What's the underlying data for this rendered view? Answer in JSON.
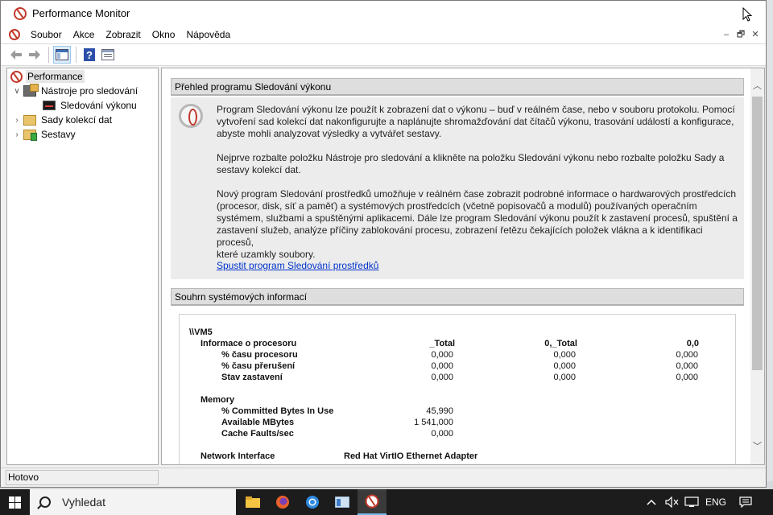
{
  "window": {
    "title": "Performance Monitor",
    "mdi_controls": [
      "–",
      "🗗",
      "✕"
    ]
  },
  "menu": [
    "Soubor",
    "Akce",
    "Zobrazit",
    "Okno",
    "Nápověda"
  ],
  "toolbar_icons": [
    "back-arrow-icon",
    "forward-arrow-icon",
    "show-hide-console-tree-icon",
    "help-icon",
    "properties-icon"
  ],
  "tree": {
    "root": "Performance",
    "items": [
      {
        "label": "Nástroje pro sledování",
        "expanded": true
      },
      {
        "label": "Sledování výkonu"
      },
      {
        "label": "Sady kolekcí dat",
        "expanded": false
      },
      {
        "label": "Sestavy",
        "expanded": false
      }
    ]
  },
  "overview": {
    "header": "Přehled programu Sledování výkonu",
    "p1_l1": "Program Sledování výkonu lze použít k zobrazení dat o výkonu – buď v reálném čase, nebo v souboru protokolu. Pomocí",
    "p1_l2": "vytvoření sad kolekcí dat nakonfigurujte a naplánujte shromažďování dat čítačů výkonu, trasování událostí a konfigurace,",
    "p1_l3": "abyste mohli analyzovat výsledky a vytvářet sestavy.",
    "p2_l1": "Nejprve rozbalte položku Nástroje pro sledování a klikněte na položku Sledování výkonu nebo rozbalte položku Sady a",
    "p2_l2": "sestavy kolekcí dat.",
    "p3_l1": "Nový program Sledování prostředků umožňuje v reálném čase zobrazit podrobné informace o hardwarových prostředcích",
    "p3_l2": "(procesor, disk, síť a paměť) a systémových prostředcích (včetně popisovačů a modulů) používaných operačním",
    "p3_l3": "systémem, službami a spuštěnými aplikacemi. Dále lze program Sledování výkonu použít k zastavení procesů, spuštění a",
    "p3_l4": "zastavení služeb, analýze příčiny zablokování procesu, zobrazení řetězu čekajících položek vlákna a k identifikaci procesů,",
    "p3_l5": "které uzamkly soubory.",
    "link": "Spustit program Sledování prostředků"
  },
  "sysinfo": {
    "header": "Souhrn systémových informací",
    "machine": "\\\\VM5",
    "cpu_title": "Informace o procesoru",
    "cols": [
      "_Total",
      "0,_Total",
      "0,0"
    ],
    "cpu_rows": [
      {
        "label": "% času procesoru",
        "values": [
          "0,000",
          "0,000",
          "0,000"
        ]
      },
      {
        "label": "% času přerušení",
        "values": [
          "0,000",
          "0,000",
          "0,000"
        ]
      },
      {
        "label": "Stav zastavení",
        "values": [
          "0,000",
          "0,000",
          "0,000"
        ]
      }
    ],
    "mem_title": "Memory",
    "mem_rows": [
      {
        "label": "% Committed Bytes In Use",
        "value": "45,990"
      },
      {
        "label": "Available MBytes",
        "value": "1 541,000"
      },
      {
        "label": "Cache Faults/sec",
        "value": "0,000"
      }
    ],
    "net_title": "Network Interface",
    "net_adapter": "Red Hat VirtIO Ethernet Adapter"
  },
  "status": "Hotovo",
  "taskbar": {
    "search_placeholder": "Vyhledat",
    "apps": [
      "file-explorer-icon",
      "firefox-icon",
      "chrome-icon",
      "window-app-icon",
      "performance-monitor-icon"
    ],
    "language": "ENG"
  }
}
